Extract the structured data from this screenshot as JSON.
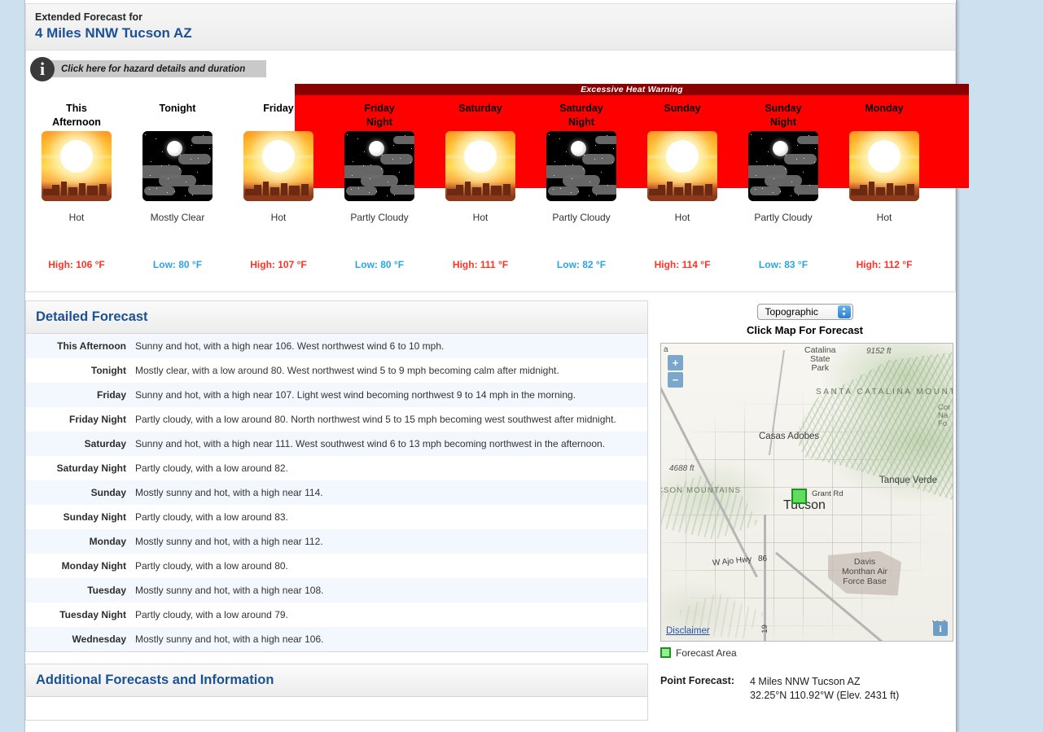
{
  "header": {
    "subtitle": "Extended Forecast for",
    "location": "4 Miles NNW Tucson AZ"
  },
  "hazard": {
    "icon": "info-icon",
    "text": "Click here for hazard details and duration"
  },
  "warning": {
    "title": "Excessive Heat Warning"
  },
  "forecast_periods": [
    {
      "name": "This Afternoon",
      "name_line1": "This",
      "name_line2": "Afternoon",
      "icon": "sunny-hot-icon",
      "condition": "Hot",
      "temp_label": "High: 106 °F",
      "temp_type": "high",
      "under_warning": false
    },
    {
      "name": "Tonight",
      "name_line1": "Tonight",
      "name_line2": "",
      "icon": "night-clear-icon",
      "condition": "Mostly Clear",
      "temp_label": "Low: 80 °F",
      "temp_type": "low",
      "under_warning": false
    },
    {
      "name": "Friday",
      "name_line1": "Friday",
      "name_line2": "",
      "icon": "sunny-hot-icon",
      "condition": "Hot",
      "temp_label": "High: 107 °F",
      "temp_type": "high",
      "under_warning": true
    },
    {
      "name": "Friday Night",
      "name_line1": "Friday",
      "name_line2": "Night",
      "icon": "night-cloudy-icon",
      "condition": "Partly Cloudy",
      "temp_label": "Low: 80 °F",
      "temp_type": "low",
      "under_warning": true
    },
    {
      "name": "Saturday",
      "name_line1": "Saturday",
      "name_line2": "",
      "icon": "sunny-hot-icon",
      "condition": "Hot",
      "temp_label": "High: 111 °F",
      "temp_type": "high",
      "under_warning": true
    },
    {
      "name": "Saturday Night",
      "name_line1": "Saturday",
      "name_line2": "Night",
      "icon": "night-cloudy-icon",
      "condition": "Partly Cloudy",
      "temp_label": "Low: 82 °F",
      "temp_type": "low",
      "under_warning": true
    },
    {
      "name": "Sunday",
      "name_line1": "Sunday",
      "name_line2": "",
      "icon": "sunny-hot-icon",
      "condition": "Hot",
      "temp_label": "High: 114 °F",
      "temp_type": "high",
      "under_warning": true
    },
    {
      "name": "Sunday Night",
      "name_line1": "Sunday",
      "name_line2": "Night",
      "icon": "night-cloudy-icon",
      "condition": "Partly Cloudy",
      "temp_label": "Low: 83 °F",
      "temp_type": "low",
      "under_warning": true
    },
    {
      "name": "Monday",
      "name_line1": "Monday",
      "name_line2": "",
      "icon": "sunny-hot-icon",
      "condition": "Hot",
      "temp_label": "High: 112 °F",
      "temp_type": "high",
      "under_warning": true
    }
  ],
  "detailed": {
    "title": "Detailed Forecast",
    "rows": [
      {
        "label": "This Afternoon",
        "text": "Sunny and hot, with a high near 106. West northwest wind 6 to 10 mph."
      },
      {
        "label": "Tonight",
        "text": "Mostly clear, with a low around 80. West northwest wind 5 to 9 mph becoming calm after midnight."
      },
      {
        "label": "Friday",
        "text": "Sunny and hot, with a high near 107. Light west wind becoming northwest 9 to 14 mph in the morning."
      },
      {
        "label": "Friday Night",
        "text": "Partly cloudy, with a low around 80. North northwest wind 5 to 15 mph becoming west southwest after midnight."
      },
      {
        "label": "Saturday",
        "text": "Sunny and hot, with a high near 111. West southwest wind 6 to 13 mph becoming northwest in the afternoon."
      },
      {
        "label": "Saturday Night",
        "text": "Partly cloudy, with a low around 82."
      },
      {
        "label": "Sunday",
        "text": "Mostly sunny and hot, with a high near 114."
      },
      {
        "label": "Sunday Night",
        "text": "Partly cloudy, with a low around 83."
      },
      {
        "label": "Monday",
        "text": "Mostly sunny and hot, with a high near 112."
      },
      {
        "label": "Monday Night",
        "text": "Partly cloudy, with a low around 80."
      },
      {
        "label": "Tuesday",
        "text": "Mostly sunny and hot, with a high near 108."
      },
      {
        "label": "Tuesday Night",
        "text": "Partly cloudy, with a low around 79."
      },
      {
        "label": "Wednesday",
        "text": "Mostly sunny and hot, with a high near 106."
      }
    ]
  },
  "additional": {
    "title": "Additional Forecasts and Information"
  },
  "map": {
    "basemap_selected": "Topographic",
    "click_caption": "Click Map For Forecast",
    "zoom_in": "+",
    "zoom_out": "−",
    "disclaimer": "Disclaimer",
    "info_button": "i",
    "corner_letter": "a",
    "legend_label": "Forecast Area",
    "labels": {
      "catalina_state_park": "Catalina\nState\nPark",
      "elev_9152": "9152 ft",
      "santa_catalina": "SANTA CATALINA MOUNT",
      "coronado": "Cor\nNa\nFo",
      "casas_adobes": "Casas Adobes",
      "elev_4688": "4688 ft",
      "tucson_mountains": "CSON MOUNTAINS",
      "tanque_verde": "Tanque Verde",
      "grant_rd": "Grant Rd",
      "tucson": "Tucson",
      "ajo_hwy": "W Ajo Hwy",
      "route_86": "86",
      "route_19": "19",
      "davis_monthan": "Davis\nMonthan Air\nForce Base",
      "vail": "Vail"
    }
  },
  "point_forecast": {
    "label": "Point Forecast:",
    "location": "4 Miles NNW Tucson AZ",
    "coords": "32.25°N 110.92°W (Elev. 2431 ft)"
  },
  "colors": {
    "high_temp": "#ff3224",
    "low_temp": "#29a5e3",
    "warning_bg": "#ff0000",
    "warning_title_bg": "#8a0000",
    "heading_blue": "#1b5293",
    "page_bg": "#cce0f0"
  }
}
